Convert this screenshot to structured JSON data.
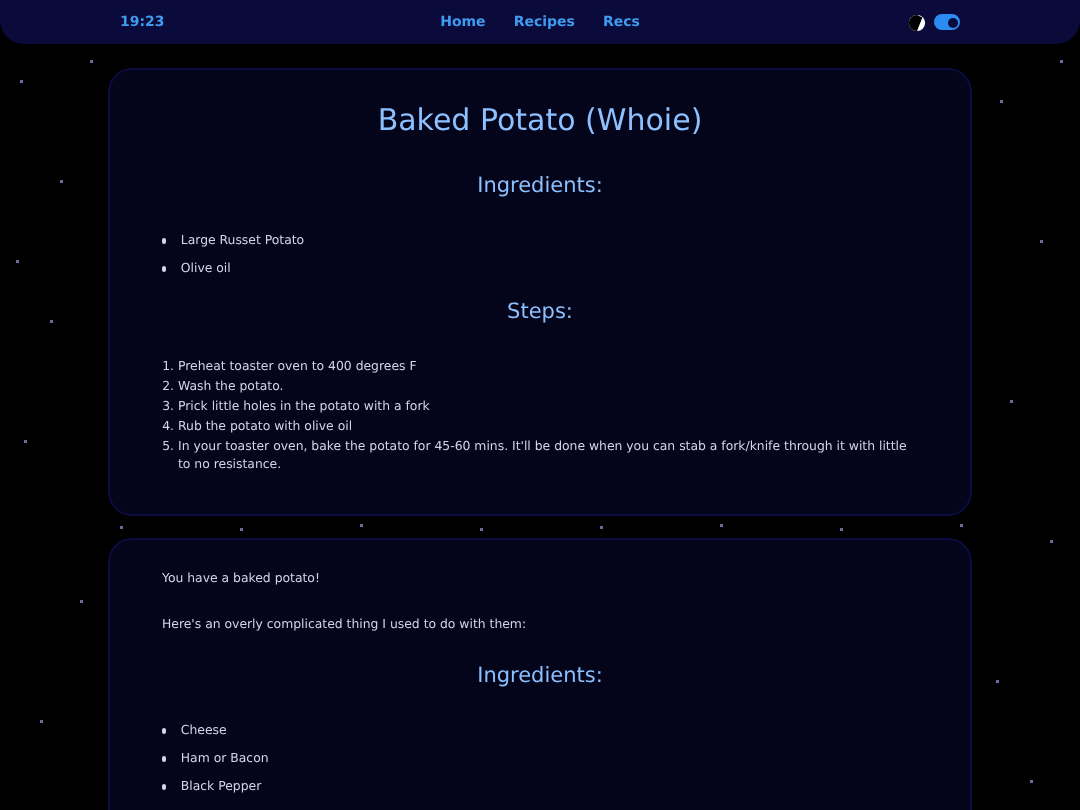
{
  "header": {
    "time": "19:23",
    "nav": [
      {
        "label": "Home"
      },
      {
        "label": "Recipes"
      },
      {
        "label": "Recs"
      }
    ],
    "theme_switch": {
      "on": true
    }
  },
  "cards": [
    {
      "blocks": [
        {
          "kind": "title",
          "text": "Baked Potato (Whoie)"
        },
        {
          "kind": "heading",
          "text": "Ingredients:"
        },
        {
          "kind": "bullets",
          "items": [
            "Large Russet Potato",
            "Olive oil"
          ]
        },
        {
          "kind": "heading",
          "text": "Steps:"
        },
        {
          "kind": "steps",
          "items": [
            {
              "number": "1.",
              "text": "Preheat toaster oven to 400 degrees F"
            },
            {
              "number": "2.",
              "text": "Wash the potato."
            },
            {
              "number": "3.",
              "text": "Prick little holes in the potato with a fork"
            },
            {
              "number": "4.",
              "text": "Rub the potato with olive oil"
            },
            {
              "number": "5.",
              "text": "In your toaster oven, bake the potato for 45-60 mins. It'll be done when you can stab a fork/knife through it with little to no resistance."
            }
          ]
        }
      ]
    },
    {
      "blocks": [
        {
          "kind": "paragraph",
          "text": "You have a baked potato!"
        },
        {
          "kind": "paragraph",
          "text": "Here's an overly complicated thing I used to do with them:"
        },
        {
          "kind": "heading",
          "text": "Ingredients:"
        },
        {
          "kind": "bullets",
          "items": [
            "Cheese",
            "Ham or Bacon",
            "Black Pepper"
          ]
        }
      ]
    }
  ]
}
